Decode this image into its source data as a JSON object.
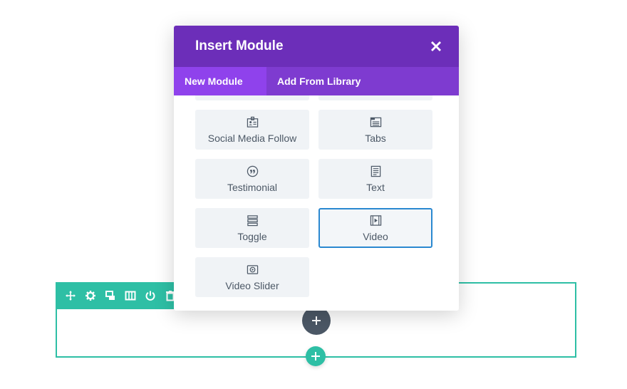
{
  "modal": {
    "title": "Insert Module",
    "close_icon": "close-icon",
    "tabs": [
      {
        "label": "New Module",
        "active": true
      },
      {
        "label": "Add From Library",
        "active": false
      }
    ],
    "modules": [
      {
        "label": "Social Media Follow",
        "icon": "social-follow-icon"
      },
      {
        "label": "Tabs",
        "icon": "tabs-icon"
      },
      {
        "label": "Testimonial",
        "icon": "quote-icon"
      },
      {
        "label": "Text",
        "icon": "text-icon"
      },
      {
        "label": "Toggle",
        "icon": "toggle-icon"
      },
      {
        "label": "Video",
        "icon": "video-icon",
        "selected": true
      },
      {
        "label": "Video Slider",
        "icon": "video-slider-icon"
      }
    ]
  },
  "row_toolbar": {
    "icons": [
      "move-icon",
      "gear-icon",
      "duplicate-icon",
      "columns-icon",
      "power-icon",
      "trash-icon"
    ]
  },
  "colors": {
    "header": "#6c2eb9",
    "tabs_bar": "#7e3bd0",
    "active_tab": "#8f42ec",
    "row_accent": "#2ebfa5",
    "selected_border": "#2a88d0",
    "module_bg": "#f0f3f6",
    "dark_button": "#4c5866"
  }
}
